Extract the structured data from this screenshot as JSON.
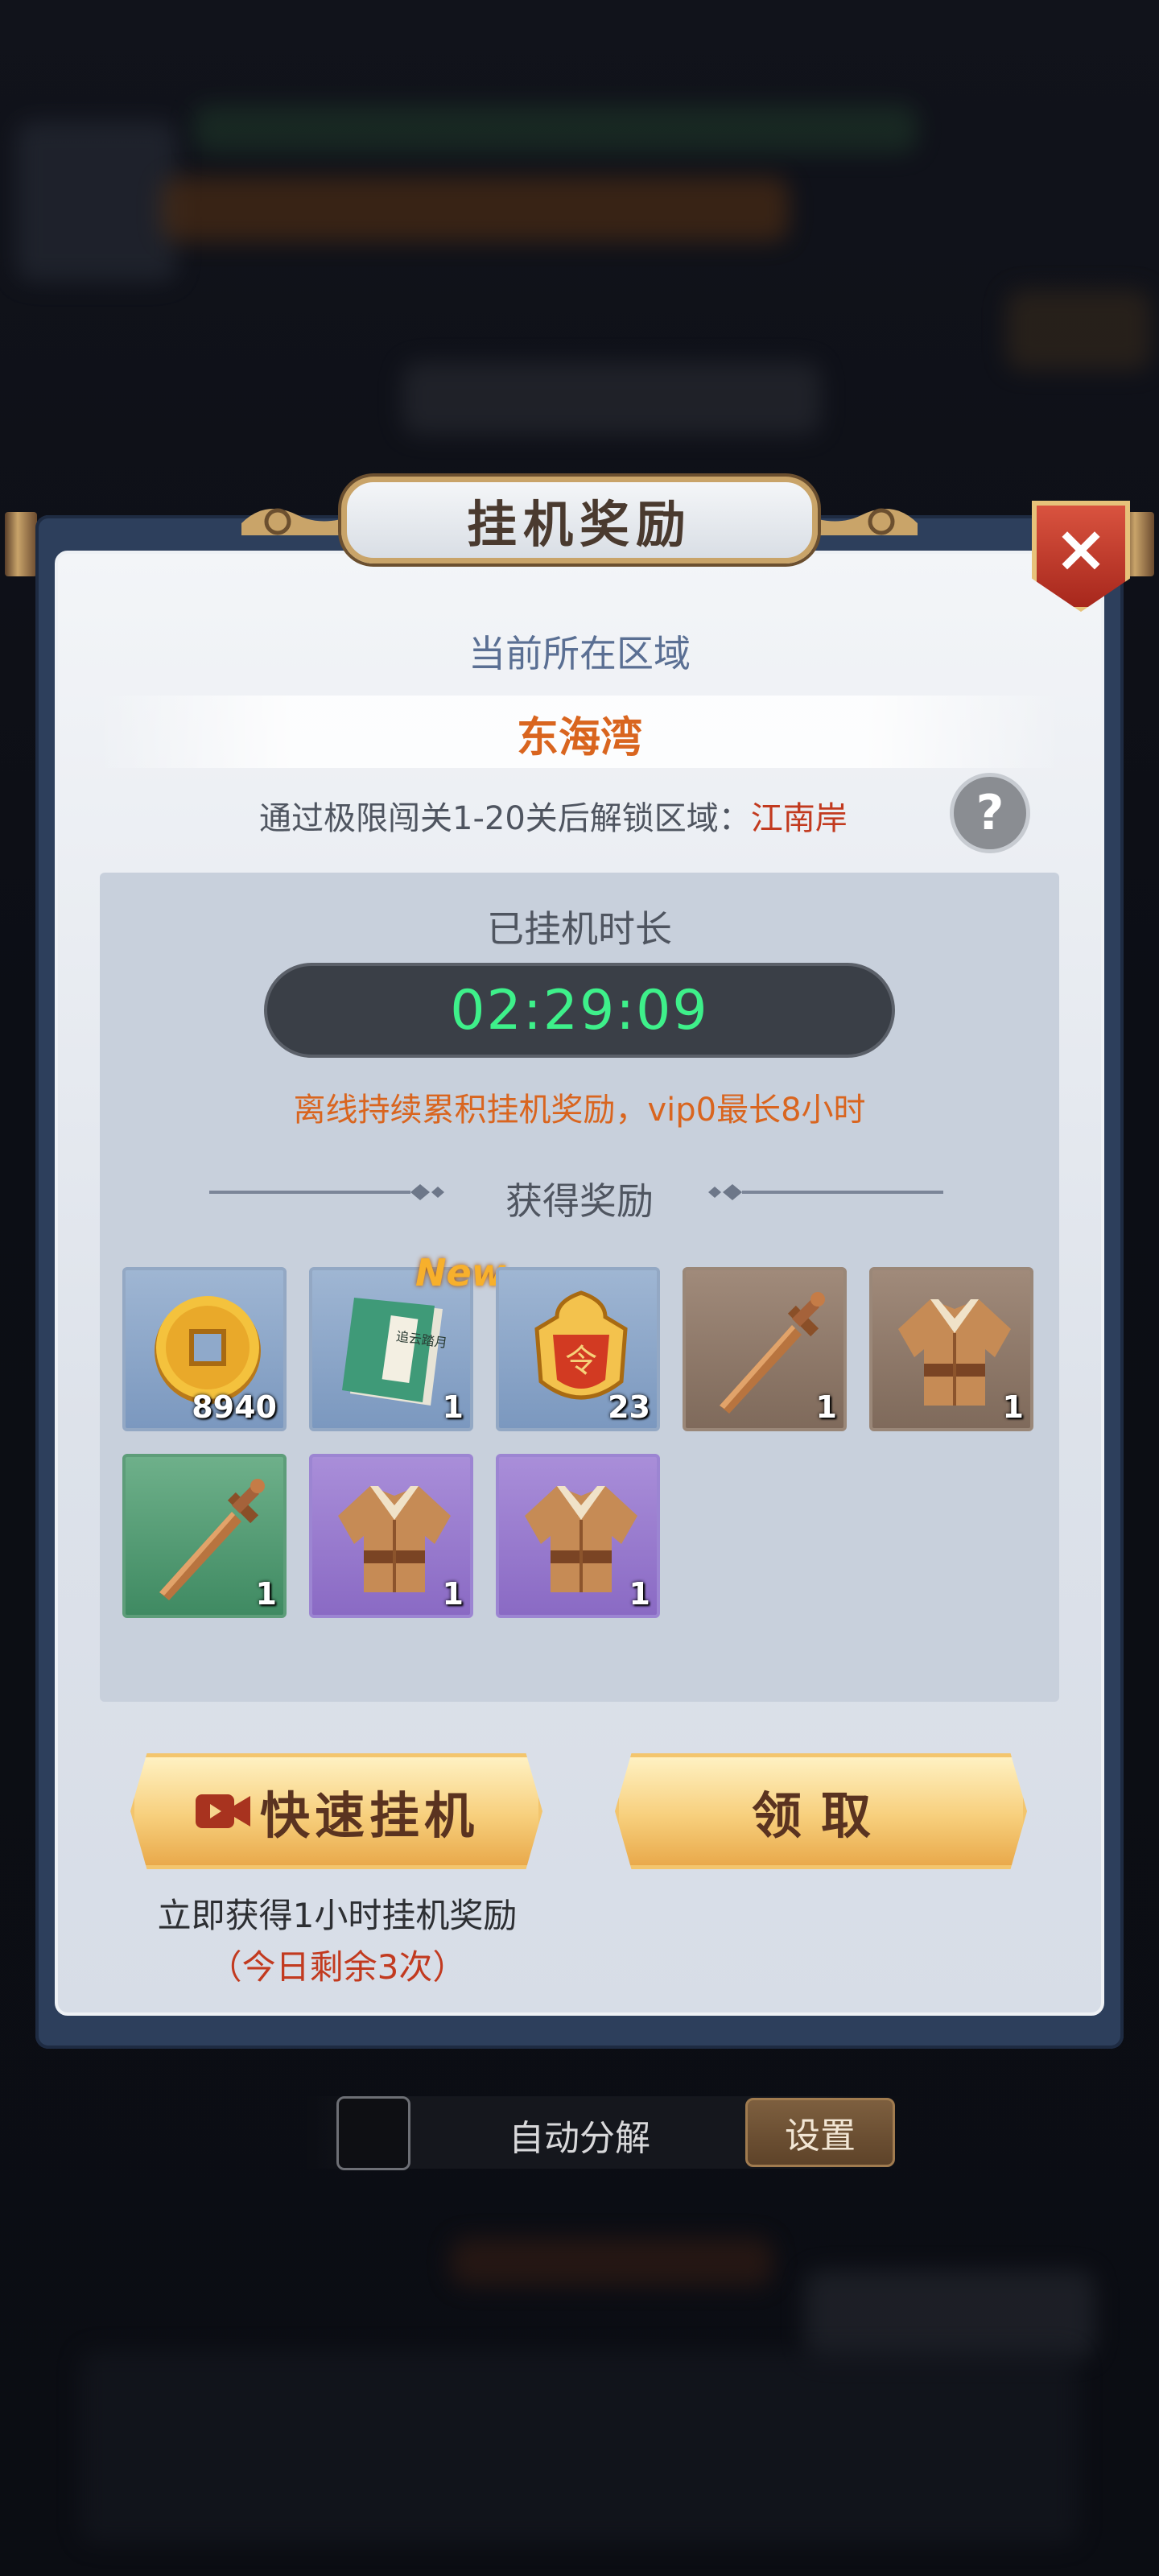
{
  "modal": {
    "title": "挂机奖励",
    "close_label": "×",
    "region_heading": "当前所在区域",
    "region_name": "东海湾",
    "unlock_prefix": "通过极限闯关1-20关后解锁区域：",
    "unlock_region": "江南岸",
    "help_label": "?",
    "idle_heading": "已挂机时长",
    "idle_time": "02:29:09",
    "idle_note": "离线持续累积挂机奖励，vip0最长8小时",
    "rewards_heading": "获得奖励",
    "new_tag": "New",
    "rewards": [
      {
        "name": "coin",
        "icon": "copper-coin-icon",
        "count": "8940",
        "frame": "blue"
      },
      {
        "name": "book",
        "icon": "skill-book-icon",
        "count": "1",
        "frame": "blue",
        "book_title": "追云踏月"
      },
      {
        "name": "token",
        "icon": "command-token-icon",
        "count": "23",
        "frame": "blue",
        "token_char": "令"
      },
      {
        "name": "sword",
        "icon": "sword-icon",
        "count": "1",
        "frame": "brown"
      },
      {
        "name": "armor",
        "icon": "armor-icon",
        "count": "1",
        "frame": "brown"
      },
      {
        "name": "sword",
        "icon": "sword-icon",
        "count": "1",
        "frame": "green"
      },
      {
        "name": "armor",
        "icon": "armor-icon",
        "count": "1",
        "frame": "purple"
      },
      {
        "name": "armor",
        "icon": "armor-icon",
        "count": "1",
        "frame": "purple"
      }
    ],
    "quick_idle_label": "快速挂机",
    "claim_label": "领取",
    "quick_desc": "立即获得1小时挂机奖励",
    "quick_remaining": "（今日剩余3次）"
  },
  "bottom_bar": {
    "auto_decompose_label": "自动分解",
    "settings_label": "设置",
    "auto_decompose_checked": false
  },
  "colors": {
    "accent_orange": "#d9651f",
    "timer_green": "#3ef08a",
    "unlock_red": "#c23a1f"
  }
}
